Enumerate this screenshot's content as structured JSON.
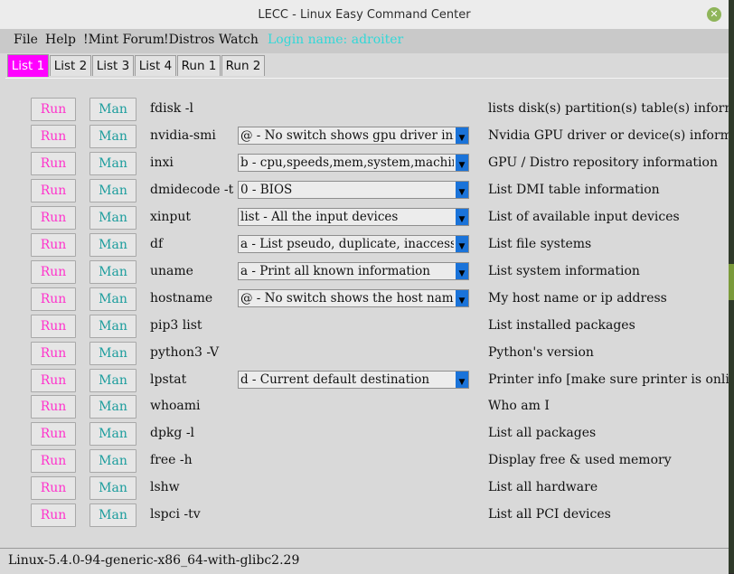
{
  "window": {
    "title": "LECC - Linux Easy Command Center",
    "close_symbol": "✕"
  },
  "menu": [
    "File",
    "Help",
    "!Mint Forum",
    "!Distros Watch"
  ],
  "login": "Login name: adroiter",
  "tabs": [
    {
      "label": "List 1",
      "active": true
    },
    {
      "label": "List 2"
    },
    {
      "label": "List 3"
    },
    {
      "label": "List 4"
    },
    {
      "label": "Run 1"
    },
    {
      "label": "Run 2"
    }
  ],
  "run_label": "Run",
  "man_label": "Man",
  "rows": [
    {
      "cmd": "fdisk -l",
      "option": null,
      "desc": "lists disk(s) partition(s) table(s) information"
    },
    {
      "cmd": "nvidia-smi",
      "option": "@ - No switch shows gpu driver info",
      "desc": "Nvidia GPU driver or device(s) information"
    },
    {
      "cmd": "inxi",
      "option": "b - cpu,speeds,mem,system,machine,cpu",
      "desc": "GPU / Distro repository information"
    },
    {
      "cmd": "dmidecode -t",
      "option": "0 - BIOS",
      "desc": "List DMI table information"
    },
    {
      "cmd": "xinput",
      "option": "list - All the input devices",
      "desc": "List of available input devices"
    },
    {
      "cmd": "df",
      "option": "a - List pseudo, duplicate, inaccessible",
      "desc": "List file systems"
    },
    {
      "cmd": "uname",
      "option": "a - Print all known information",
      "desc": "List system information"
    },
    {
      "cmd": "hostname",
      "option": "@ - No switch shows the host name",
      "desc": "My host name or ip address"
    },
    {
      "cmd": "pip3 list",
      "option": null,
      "desc": "List installed packages"
    },
    {
      "cmd": "python3 -V",
      "option": null,
      "desc": "Python's version"
    },
    {
      "cmd": "lpstat",
      "option": "d - Current default destination",
      "desc": "Printer info [make sure printer is online]"
    },
    {
      "cmd": "whoami",
      "option": null,
      "desc": "Who am I"
    },
    {
      "cmd": "dpkg -l",
      "option": null,
      "desc": "List all packages"
    },
    {
      "cmd": "free -h",
      "option": null,
      "desc": "Display free & used memory"
    },
    {
      "cmd": "lshw",
      "option": null,
      "desc": "List all hardware"
    },
    {
      "cmd": "lspci -tv",
      "option": null,
      "desc": "List all PCI devices"
    }
  ],
  "status": "Linux-5.4.0-94-generic-x86_64-with-glibc2.29",
  "colors": {
    "active_tab": "#ff00ff",
    "run_text": "#ff33cc",
    "man_text": "#1c9d9d",
    "login_text": "#32d8d8",
    "combo_arrow": "#1a73d9"
  }
}
